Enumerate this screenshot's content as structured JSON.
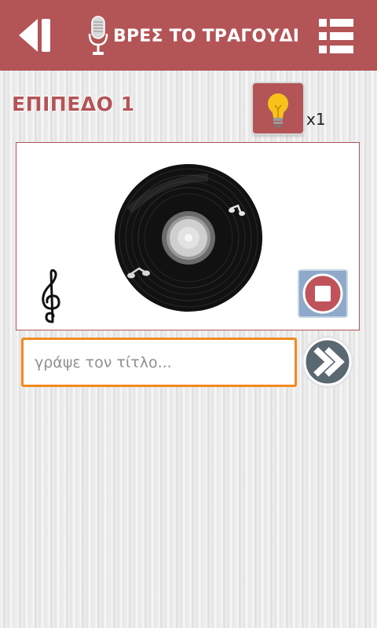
{
  "header": {
    "title": "ΒΡΕΣ ΤΟ ΤΡΑΓΟΥΔΙ",
    "back_icon": "back-icon",
    "mic_icon": "microphone-icon",
    "menu_icon": "list-menu-icon"
  },
  "level": {
    "label": "ΕΠΙΠΕΔΟ 1"
  },
  "hint": {
    "icon": "lightbulb-icon",
    "count": "x1"
  },
  "player": {
    "disc_icon": "vinyl-record-icon",
    "clef_icon": "treble-clef-icon",
    "stop_icon": "stop-icon"
  },
  "answer": {
    "placeholder": "γράψε τον τίτλο...",
    "value": "",
    "submit_icon": "next-arrows-icon"
  },
  "colors": {
    "brand": "#b35457",
    "input_border": "#f28a1f",
    "stop_button": "#c0525a",
    "stop_frame": "#8ea9c9",
    "submit_button": "#5a6872"
  }
}
